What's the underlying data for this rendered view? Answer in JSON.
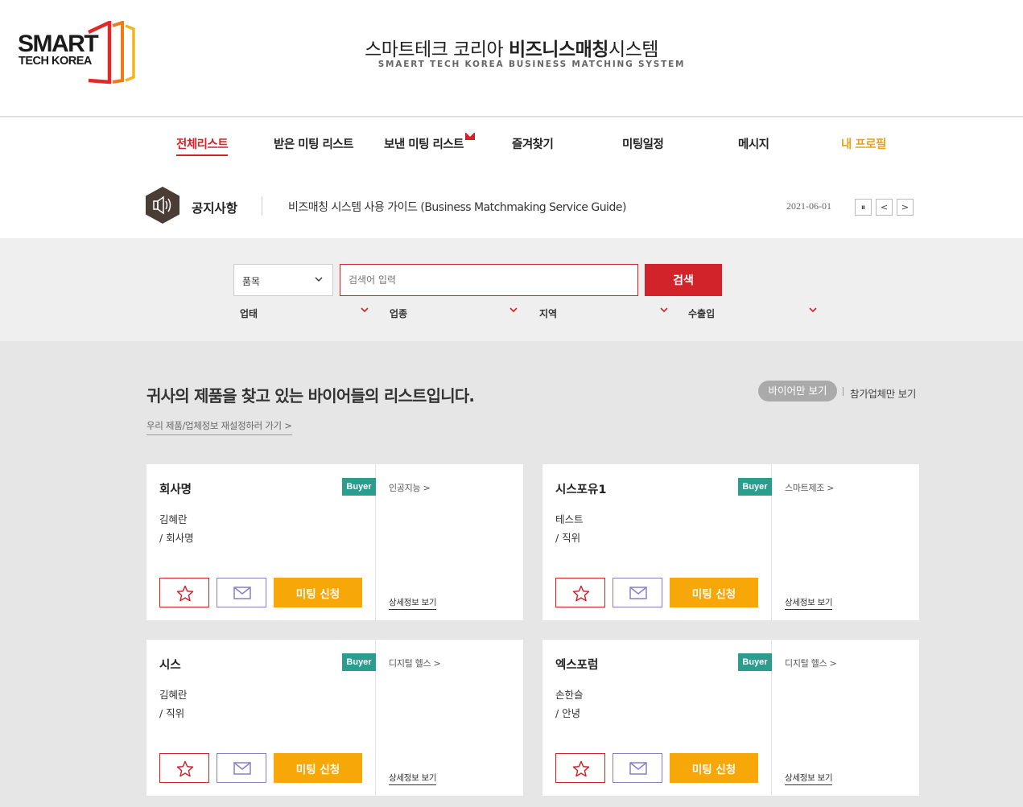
{
  "header": {
    "logo_line1": "SMART",
    "logo_line2": "TECH KOREA",
    "title_normal": "스마트테크 코리아 ",
    "title_bold": "비즈니스매칭",
    "title_end": "시스템",
    "subtitle": "SMAERT TECH KOREA BUSINESS MATCHING SYSTEM"
  },
  "nav": [
    {
      "label": "전체리스트"
    },
    {
      "label": "받은 미팅 리스트"
    },
    {
      "label": "보낸 미팅 리스트"
    },
    {
      "label": "즐겨찾기"
    },
    {
      "label": "미팅일정"
    },
    {
      "label": "메시지"
    },
    {
      "label": "내 프로필"
    }
  ],
  "notice": {
    "label": "공지사항",
    "text": "비즈매칭 시스템 사용 가이드 (Business Matchmaking Service Guide)",
    "date": "2021-06-01"
  },
  "search": {
    "select_value": "품목",
    "placeholder": "검색어 입력",
    "button": "검색",
    "filters": [
      "업태",
      "업종",
      "지역",
      "수출입"
    ]
  },
  "main": {
    "title": "귀사의 제품을 찾고 있는 바이어들의 리스트입니다.",
    "reset_link": "우리 제품/업체정보 재설정하러 가기 >",
    "toggle_active": "바이어만 보기",
    "toggle_other": "참가업체만 보기"
  },
  "cards": [
    {
      "company": "회사명",
      "badge": "Buyer",
      "name": "김혜란",
      "title": "/ 회사명",
      "category": "인공지능 >",
      "meet": "미팅 신청",
      "detail": "상세정보 보기"
    },
    {
      "company": "시스포유1",
      "badge": "Buyer",
      "name": "테스트",
      "title": "/ 직위",
      "category": "스마트제조 >",
      "meet": "미팅 신청",
      "detail": "상세정보 보기"
    },
    {
      "company": "시스",
      "badge": "Buyer",
      "name": "김혜란",
      "title": "/ 직위",
      "category": "디지털 헬스 >",
      "meet": "미팅 신청",
      "detail": "상세정보 보기"
    },
    {
      "company": "엑스포럼",
      "badge": "Buyer",
      "name": "손한슬",
      "title": "/ 안녕",
      "category": "디지털 헬스 >",
      "meet": "미팅 신청",
      "detail": "상세정보 보기"
    }
  ],
  "colors": {
    "brand_red": "#d2232a",
    "accent_orange": "#f7a707",
    "buyer_teal": "#2a9d8f",
    "profile_gold": "#e8a317"
  }
}
